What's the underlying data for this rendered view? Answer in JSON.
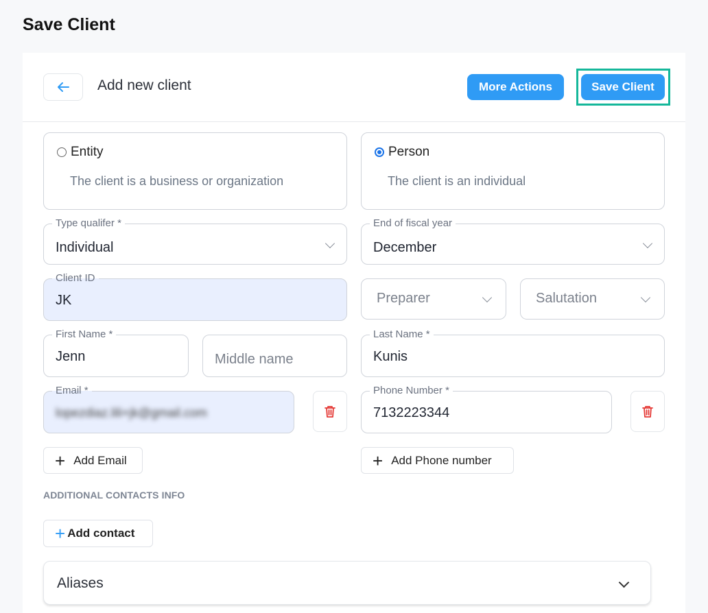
{
  "page": {
    "title": "Save Client"
  },
  "header": {
    "title": "Add new client",
    "more_actions_label": "More Actions",
    "save_label": "Save Client",
    "accent_color": "#2f9bf5",
    "highlight_color": "#15b79a"
  },
  "client_type": {
    "entity": {
      "label": "Entity",
      "description": "The client is a business or organization",
      "selected": false
    },
    "person": {
      "label": "Person",
      "description": "The client is an individual",
      "selected": true
    }
  },
  "fields": {
    "type_qualifier": {
      "label": "Type qualifer",
      "required_mark": "*",
      "value": "Individual"
    },
    "fiscal_year_end": {
      "label": "End of fiscal year",
      "value": "December"
    },
    "client_id": {
      "label": "Client ID",
      "value": "JK"
    },
    "preparer": {
      "placeholder": "Preparer"
    },
    "salutation": {
      "placeholder": "Salutation"
    },
    "first_name": {
      "label": "First Name",
      "required_mark": "*",
      "value": "Jenn"
    },
    "middle_name": {
      "placeholder": "Middle name"
    },
    "last_name": {
      "label": "Last Name",
      "required_mark": "*",
      "value": "Kunis"
    },
    "email": {
      "label": "Email",
      "required_mark": "*",
      "value": "lopezdiaz.lili+jk@gmail.com"
    },
    "phone": {
      "label": "Phone Number",
      "required_mark": "*",
      "value": "7132223344"
    }
  },
  "actions": {
    "add_email": "Add Email",
    "add_phone": "Add Phone number",
    "add_contact": "Add contact"
  },
  "sections": {
    "additional_contacts": "ADDITIONAL CONTACTS INFO",
    "aliases": "Aliases"
  },
  "icons": {
    "back": "arrow-left-icon",
    "trash": "trash-icon",
    "plus": "plus-icon",
    "chevron": "chevron-down-icon"
  }
}
